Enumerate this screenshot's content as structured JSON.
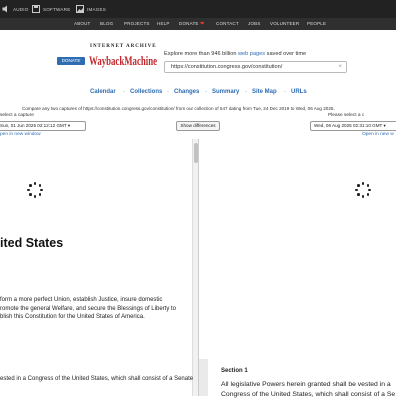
{
  "topbar": {
    "items": [
      {
        "label": "AUDIO",
        "icon": "speaker-icon"
      },
      {
        "label": "SOFTWARE",
        "icon": "floppy-disk-icon"
      },
      {
        "label": "IMAGES",
        "icon": "image-icon"
      }
    ]
  },
  "nav": {
    "links": [
      "ABOUT",
      "BLOG",
      "PROJECTS",
      "HELP",
      "DONATE",
      "CONTACT",
      "JOBS",
      "VOLUNTEER",
      "PEOPLE"
    ],
    "donate_heart": "❤"
  },
  "header": {
    "donate_label": "DONATE",
    "archive_name": "INTERNET ARCHIVE",
    "wayback_logo_text": "WaybackMachine",
    "tagline_prefix": "Explore more than 946 billion",
    "tagline_link": "web pages",
    "tagline_suffix": "saved over time",
    "url_value": "https://constitution.congress.gov/constitution/",
    "clear_symbol": "×"
  },
  "subnav": {
    "items": [
      "Calendar",
      "Collections",
      "Changes",
      "Summary",
      "Site Map",
      "URLs"
    ],
    "separator": "·"
  },
  "compare": {
    "text": "Compare any two captures of https://constitution.congress.gov/constitution/ from our collection of 547 dating from Tue, 24 Dec 2019 to Wed, 06 Aug 2025.",
    "left_label": "select a capture",
    "right_label": "Please select a c",
    "left_select": "Sun, 01 Jun 2025 02:12:12 GMT ▾",
    "right_select": "Wed, 06 Aug 2025 02:31:10 GMT ▾",
    "show_differences": "Show differences",
    "left_new_window": "pen in new window",
    "right_new_window": "Open in new w"
  },
  "left_panel": {
    "title": "ited States",
    "preamble_lines": [
      "form a more perfect Union, establish Justice, insure domestic",
      "romote the general Welfare, and secure the Blessings of Liberty to",
      "blish this Constitution for the United States of America."
    ],
    "footer_line": "ested in a Congress of the United States, which shall consist of a Senate"
  },
  "right_panel": {
    "section_heading": "Section 1",
    "section_text": "All legislative Powers herein granted shall be vested in a",
    "section_text_2": "Congress of the United States, which shall consist of a Se"
  },
  "colors": {
    "topbar_bg": "#222222",
    "navbar_bg": "#2f2f2f",
    "link_blue": "#2f6db3",
    "wayback_red": "#c1272d"
  }
}
